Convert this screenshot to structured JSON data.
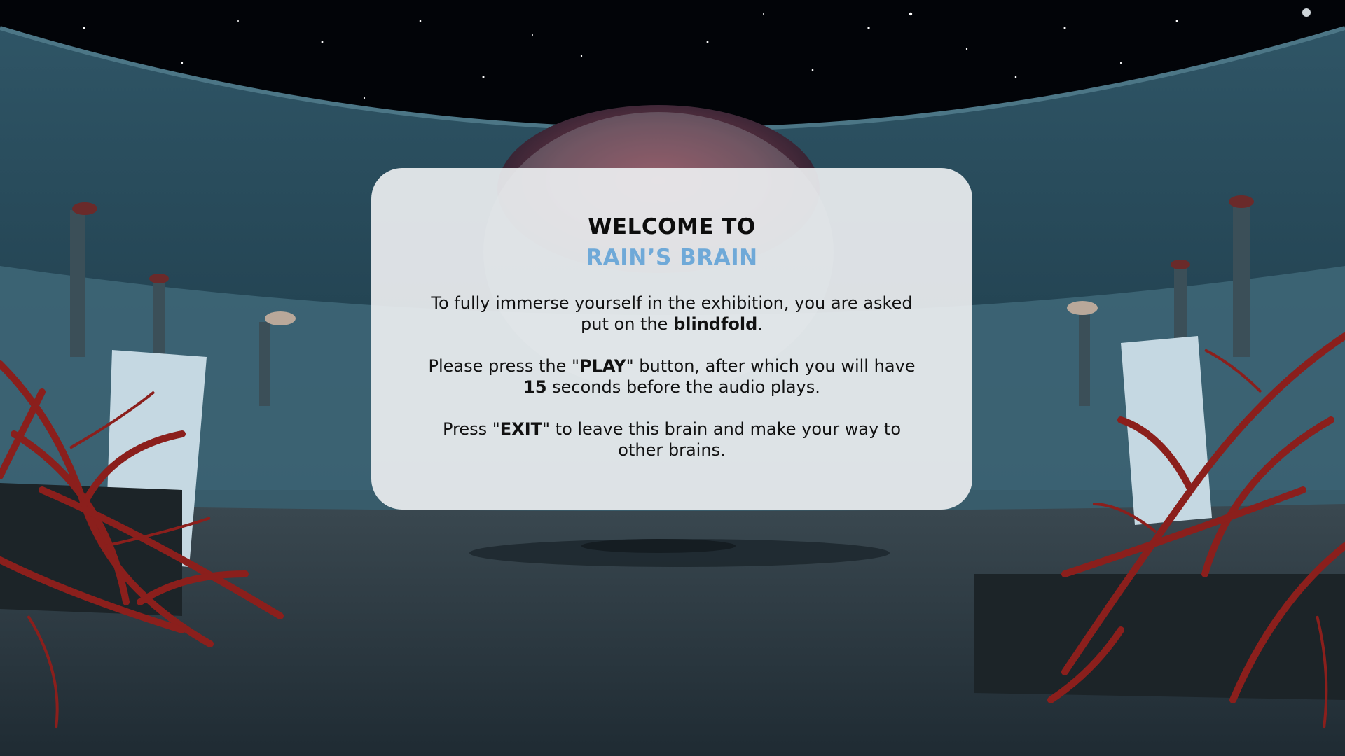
{
  "dialog": {
    "title_line1": "WELCOME TO",
    "title_line2": "RAIN’S BRAIN",
    "p1_a": "To fully immerse yourself in the exhibition, you are asked put on the ",
    "p1_bold": "blindfold",
    "p1_b": ".",
    "p2_a": "Please press the \"",
    "p2_bold1": "PLAY",
    "p2_b": "\" button, after which you will have ",
    "p2_bold2": "15",
    "p2_c": " seconds before the audio plays.",
    "p3_a": "Press \"",
    "p3_bold": "EXIT",
    "p3_b": "\" to leave this brain and make your way to other brains."
  },
  "colors": {
    "accent": "#6fa9d8",
    "panel": "#eceef0",
    "sky": "#02060a",
    "roots": "#8b1f1c"
  }
}
